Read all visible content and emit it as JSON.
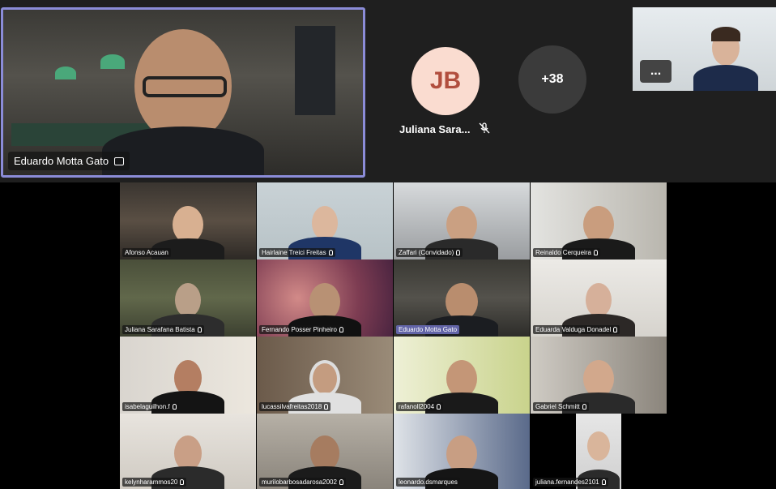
{
  "featured": {
    "name": "Eduardo Motta Gato"
  },
  "avatar": {
    "initials": "JB",
    "name": "Juliana Sara..."
  },
  "overflow": {
    "count_label": "+38"
  },
  "self_view": {
    "more_label": "..."
  },
  "grid": [
    {
      "name": "Afonso Acauan"
    },
    {
      "name": "Hairlaine Treici Freitas"
    },
    {
      "name": "Zaffari (Convidado)"
    },
    {
      "name": "Reinaldo Cerqueira"
    },
    {
      "name": "Juliana Sarafana Batista"
    },
    {
      "name": "Fernando Posser Pinheiro"
    },
    {
      "name": "Eduardo Motta Gato"
    },
    {
      "name": "Eduarda Valduga Donadel"
    },
    {
      "name": "isabelaguilhon.f"
    },
    {
      "name": "lucassilvafreitas2018"
    },
    {
      "name": "rafanoll2004"
    },
    {
      "name": "Gabriel Schmitt"
    },
    {
      "name": "kelynharammos20"
    },
    {
      "name": "murilobarbosadarosa2002"
    },
    {
      "name": "leonardo.dsmarques"
    },
    {
      "name": "juliana.fernandes2101"
    }
  ],
  "colors": {
    "accent": "#6264a7",
    "avatar_bg": "#fadcd0",
    "avatar_fg": "#b14e3e"
  }
}
